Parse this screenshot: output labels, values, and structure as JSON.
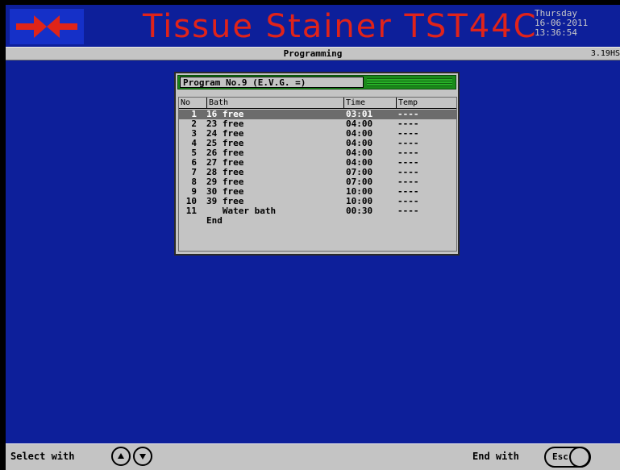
{
  "header": {
    "logo": "instrument-logo",
    "title": "Tissue Stainer TST44C",
    "day": "Thursday",
    "date": "16-06-2011",
    "time": "13:36:54"
  },
  "titlebar": {
    "mode": "Programming",
    "version": "3.19HS"
  },
  "program": {
    "name": "Program No.9 (E.V.G. =)",
    "columns": {
      "no": "No",
      "bath": "Bath",
      "time": "Time",
      "temp": "Temp"
    },
    "selected_row": 0,
    "rows": [
      {
        "no": "1",
        "bath": "16 free",
        "time": "03:01",
        "temp": "----"
      },
      {
        "no": "2",
        "bath": "23 free",
        "time": "04:00",
        "temp": "----"
      },
      {
        "no": "3",
        "bath": "24 free",
        "time": "04:00",
        "temp": "----"
      },
      {
        "no": "4",
        "bath": "25 free",
        "time": "04:00",
        "temp": "----"
      },
      {
        "no": "5",
        "bath": "26 free",
        "time": "04:00",
        "temp": "----"
      },
      {
        "no": "6",
        "bath": "27 free",
        "time": "04:00",
        "temp": "----"
      },
      {
        "no": "7",
        "bath": "28 free",
        "time": "07:00",
        "temp": "----"
      },
      {
        "no": "8",
        "bath": "29 free",
        "time": "07:00",
        "temp": "----"
      },
      {
        "no": "9",
        "bath": "30 free",
        "time": "10:00",
        "temp": "----"
      },
      {
        "no": "10",
        "bath": "39 free",
        "time": "10:00",
        "temp": "----"
      },
      {
        "no": "11",
        "bath": "   Water bath",
        "time": "00:30",
        "temp": "----"
      },
      {
        "no": "",
        "bath": "End",
        "time": "",
        "temp": ""
      }
    ]
  },
  "footer": {
    "select_label": "Select with",
    "up_icon": "arrow-up-icon",
    "down_icon": "arrow-down-icon",
    "end_label": "End with",
    "esc_label": "Esc"
  },
  "colors": {
    "background": "#0d1f9a",
    "title": "#e0231a",
    "panel": "#c4c4c4",
    "header_green": "#1a8a1a",
    "selection": "#6c6c6c"
  }
}
